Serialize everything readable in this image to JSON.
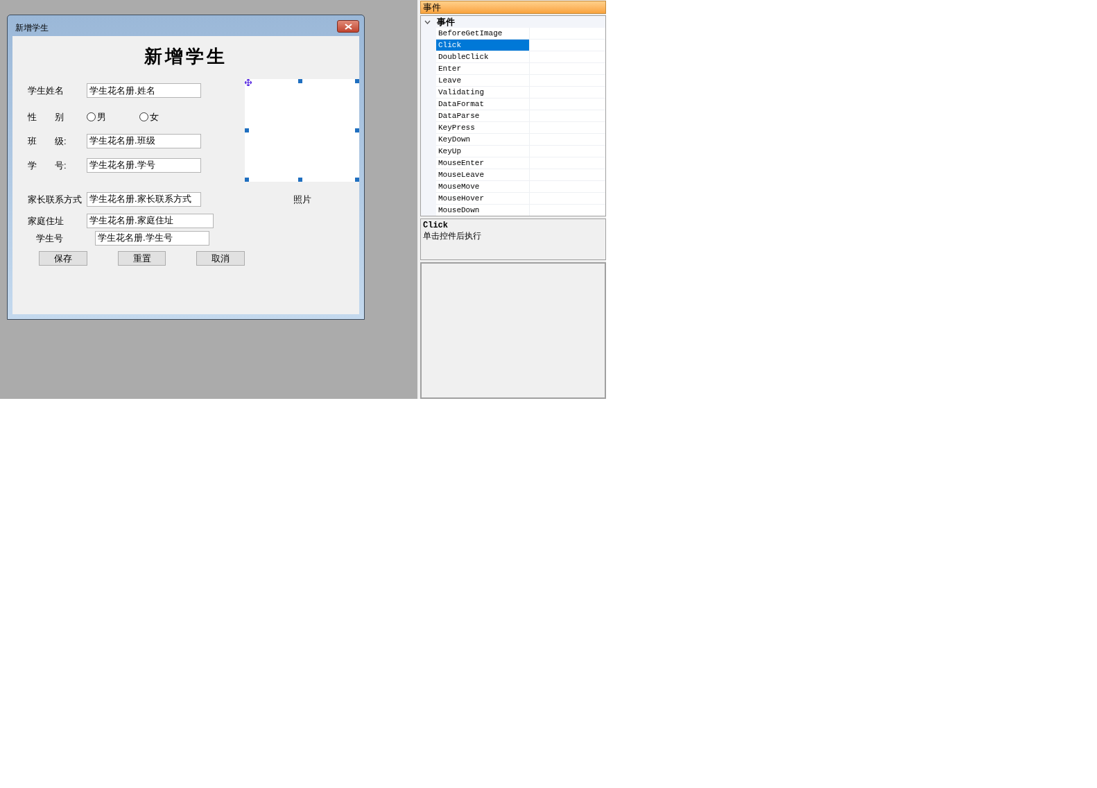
{
  "dialog": {
    "title": "新增学生",
    "heading": "新增学生",
    "rows": [
      {
        "kind": "text",
        "label": "学生姓名",
        "value": "学生花名册.姓名"
      },
      {
        "kind": "radio",
        "label": "性　　别",
        "options": [
          {
            "label": "男",
            "selected": false
          },
          {
            "label": "女",
            "selected": false
          }
        ]
      },
      {
        "kind": "text",
        "label": "班　　级:",
        "value": "学生花名册.班级"
      },
      {
        "kind": "text",
        "label": "学　　号:",
        "value": "学生花名册.学号"
      },
      {
        "kind": "text",
        "label": "家长联系方式",
        "value": "学生花名册.家长联系方式"
      },
      {
        "kind": "text",
        "label": "家庭住址",
        "value": "学生花名册.家庭住址"
      },
      {
        "kind": "text",
        "label": "学生号",
        "value": "学生花名册.学生号"
      }
    ],
    "photo_label": "照片",
    "buttons": [
      "保存",
      "重置",
      "取消"
    ]
  },
  "properties": {
    "header": "事件",
    "category": {
      "label": "事件",
      "expanded": true
    },
    "events": [
      {
        "name": "BeforeGetImage",
        "selected": false
      },
      {
        "name": "Click",
        "selected": true
      },
      {
        "name": "DoubleClick",
        "selected": false
      },
      {
        "name": "Enter",
        "selected": false
      },
      {
        "name": "Leave",
        "selected": false
      },
      {
        "name": "Validating",
        "selected": false
      },
      {
        "name": "DataFormat",
        "selected": false
      },
      {
        "name": "DataParse",
        "selected": false
      },
      {
        "name": "KeyPress",
        "selected": false
      },
      {
        "name": "KeyDown",
        "selected": false
      },
      {
        "name": "KeyUp",
        "selected": false
      },
      {
        "name": "MouseEnter",
        "selected": false
      },
      {
        "name": "MouseLeave",
        "selected": false
      },
      {
        "name": "MouseMove",
        "selected": false
      },
      {
        "name": "MouseHover",
        "selected": false
      },
      {
        "name": "MouseDown",
        "selected": false
      }
    ],
    "description": {
      "title": "Click",
      "text": "单击控件后执行"
    }
  }
}
